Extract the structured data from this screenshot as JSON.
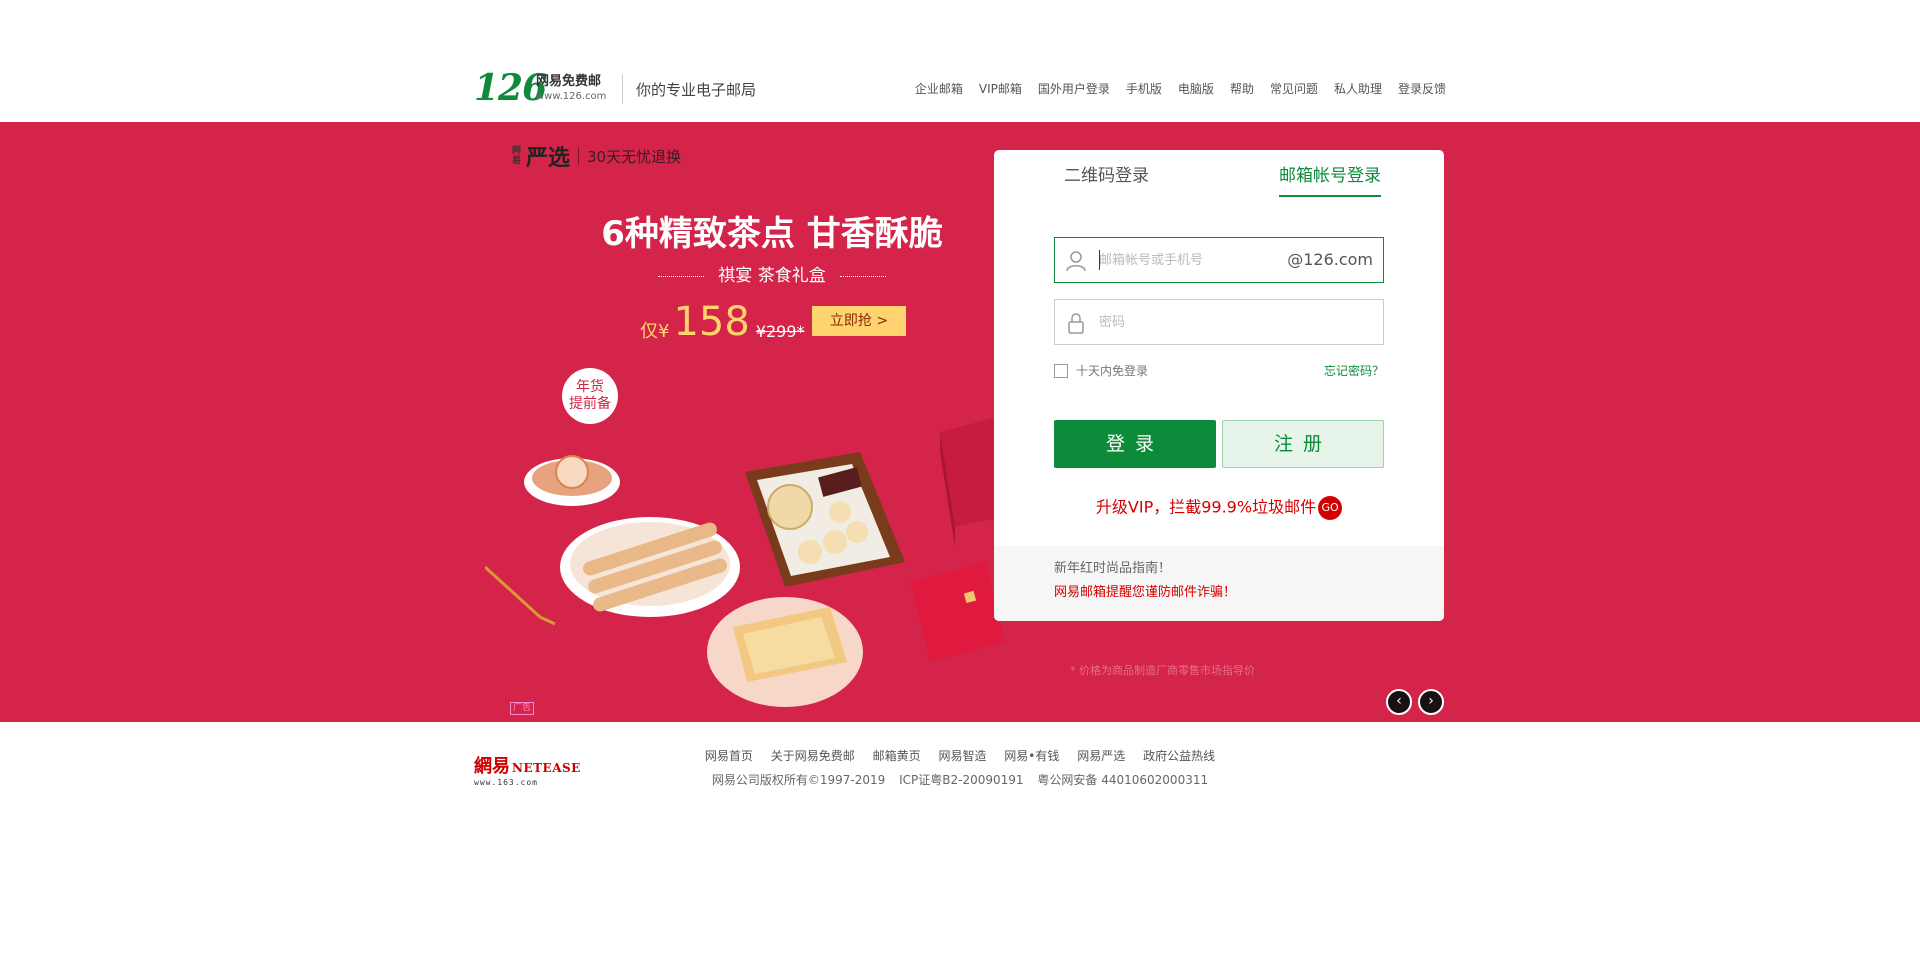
{
  "header": {
    "logo_number": "126",
    "logo_cn": "网易免费邮",
    "logo_url": "www.126.com",
    "slogan": "你的专业电子邮局",
    "nav": [
      "企业邮箱",
      "VIP邮箱",
      "国外用户登录",
      "手机版",
      "电脑版",
      "帮助",
      "常见问题",
      "私人助理",
      "登录反馈"
    ]
  },
  "banner": {
    "brand_small": "网易",
    "brand_name": "严选",
    "brand_promo": "30天无忧退换",
    "headline": "6种精致茶点 甘香酥脆",
    "subline": "祺宴 茶食礼盒",
    "price_prefix": "仅¥",
    "price": "158",
    "price_old": "¥299*",
    "buy_button": "立即抢 >",
    "badge_line1": "年货",
    "badge_line2": "提前备",
    "ad_tag": "广告",
    "disclaimer": "* 价格为商品制造厂商零售市场指导价",
    "prev_icon": "chevron-left-icon",
    "next_icon": "chevron-right-icon",
    "colors": {
      "background": "#d4244a",
      "price": "#ffd36e"
    }
  },
  "login": {
    "tab_qr": "二维码登录",
    "tab_mail": "邮箱帐号登录",
    "username_placeholder": "邮箱帐号或手机号",
    "username_value": "",
    "domain_suffix": "@126.com",
    "password_placeholder": "密码",
    "password_value": "",
    "remember_label": "十天内免登录",
    "forgot_label": "忘记密码？",
    "login_button": "登录",
    "register_button": "注册",
    "vip_text": "升级VIP，拦截99.9%垃圾邮件",
    "vip_go": "GO",
    "notice_1": "新年红时尚品指南！",
    "notice_2": "网易邮箱提醒您谨防邮件诈骗！",
    "colors": {
      "primary": "#0d8b3b",
      "alert": "#d40000"
    }
  },
  "footer": {
    "logo_cn": "網易",
    "logo_en": "NETEASE",
    "logo_url": "www.163.com",
    "links": [
      "网易首页",
      "关于网易免费邮",
      "邮箱黄页",
      "网易智造",
      "网易•有钱",
      "网易严选",
      "政府公益热线"
    ],
    "copyright": "网易公司版权所有©1997-2019",
    "icp": "ICP证粤B2-20090191",
    "police": "粤公网安备 44010602000311"
  }
}
